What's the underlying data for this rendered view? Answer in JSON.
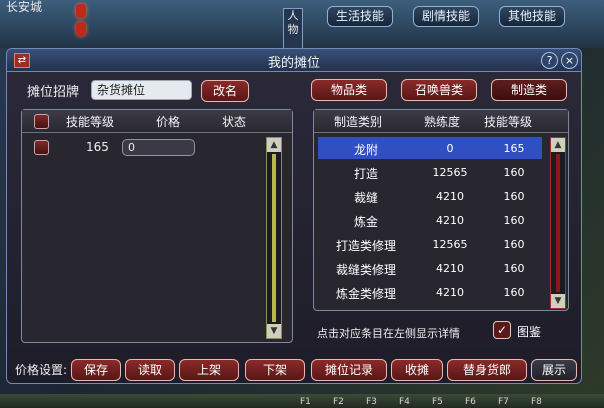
{
  "scene": {
    "city_name": "长安城",
    "side_tab": "人物",
    "top_buttons": [
      "生活技能",
      "剧情技能",
      "其他技能"
    ],
    "hotkeys": [
      "F1",
      "F2",
      "F3",
      "F4",
      "F5",
      "F6",
      "F7",
      "F8"
    ]
  },
  "window": {
    "title": "我的摊位",
    "icon_glyph": "⇄",
    "help_glyph": "?",
    "close_glyph": "×"
  },
  "sign": {
    "label": "摊位招牌",
    "value": "杂货摊位",
    "rename_button": "改名"
  },
  "category_tabs": [
    {
      "label": "物品类",
      "active": false
    },
    {
      "label": "召唤兽类",
      "active": false
    },
    {
      "label": "制造类",
      "active": true
    }
  ],
  "listing_panel": {
    "headers": [
      "技能等级",
      "价格",
      "状态"
    ],
    "rows": [
      {
        "level": "165",
        "price": "0",
        "status": ""
      }
    ]
  },
  "skills_panel": {
    "headers": [
      "制造类别",
      "熟练度",
      "技能等级"
    ],
    "rows": [
      {
        "category": "龙附",
        "proficiency": "0",
        "level": "165",
        "selected": true
      },
      {
        "category": "打造",
        "proficiency": "12565",
        "level": "160",
        "selected": false
      },
      {
        "category": "裁缝",
        "proficiency": "4210",
        "level": "160",
        "selected": false
      },
      {
        "category": "炼金",
        "proficiency": "4210",
        "level": "160",
        "selected": false
      },
      {
        "category": "打造类修理",
        "proficiency": "12565",
        "level": "160",
        "selected": false
      },
      {
        "category": "裁缝类修理",
        "proficiency": "4210",
        "level": "160",
        "selected": false
      },
      {
        "category": "炼金类修理",
        "proficiency": "4210",
        "level": "160",
        "selected": false
      }
    ]
  },
  "hint_text": "点击对应条目在左侧显示详情",
  "album": {
    "label": "图鉴",
    "checked": true,
    "glyph": "✓"
  },
  "price_settings_label": "价格设置:",
  "bottom_buttons": [
    "保存",
    "读取",
    "上架",
    "下架",
    "摊位记录",
    "收摊",
    "替身货郎",
    "展示"
  ],
  "scroll_arrows": {
    "up": "▲",
    "down": "▼"
  },
  "colors": {
    "selected_row": "#2f4fc2",
    "button_red": "#7a2222",
    "accent_blue": "#38507a"
  }
}
